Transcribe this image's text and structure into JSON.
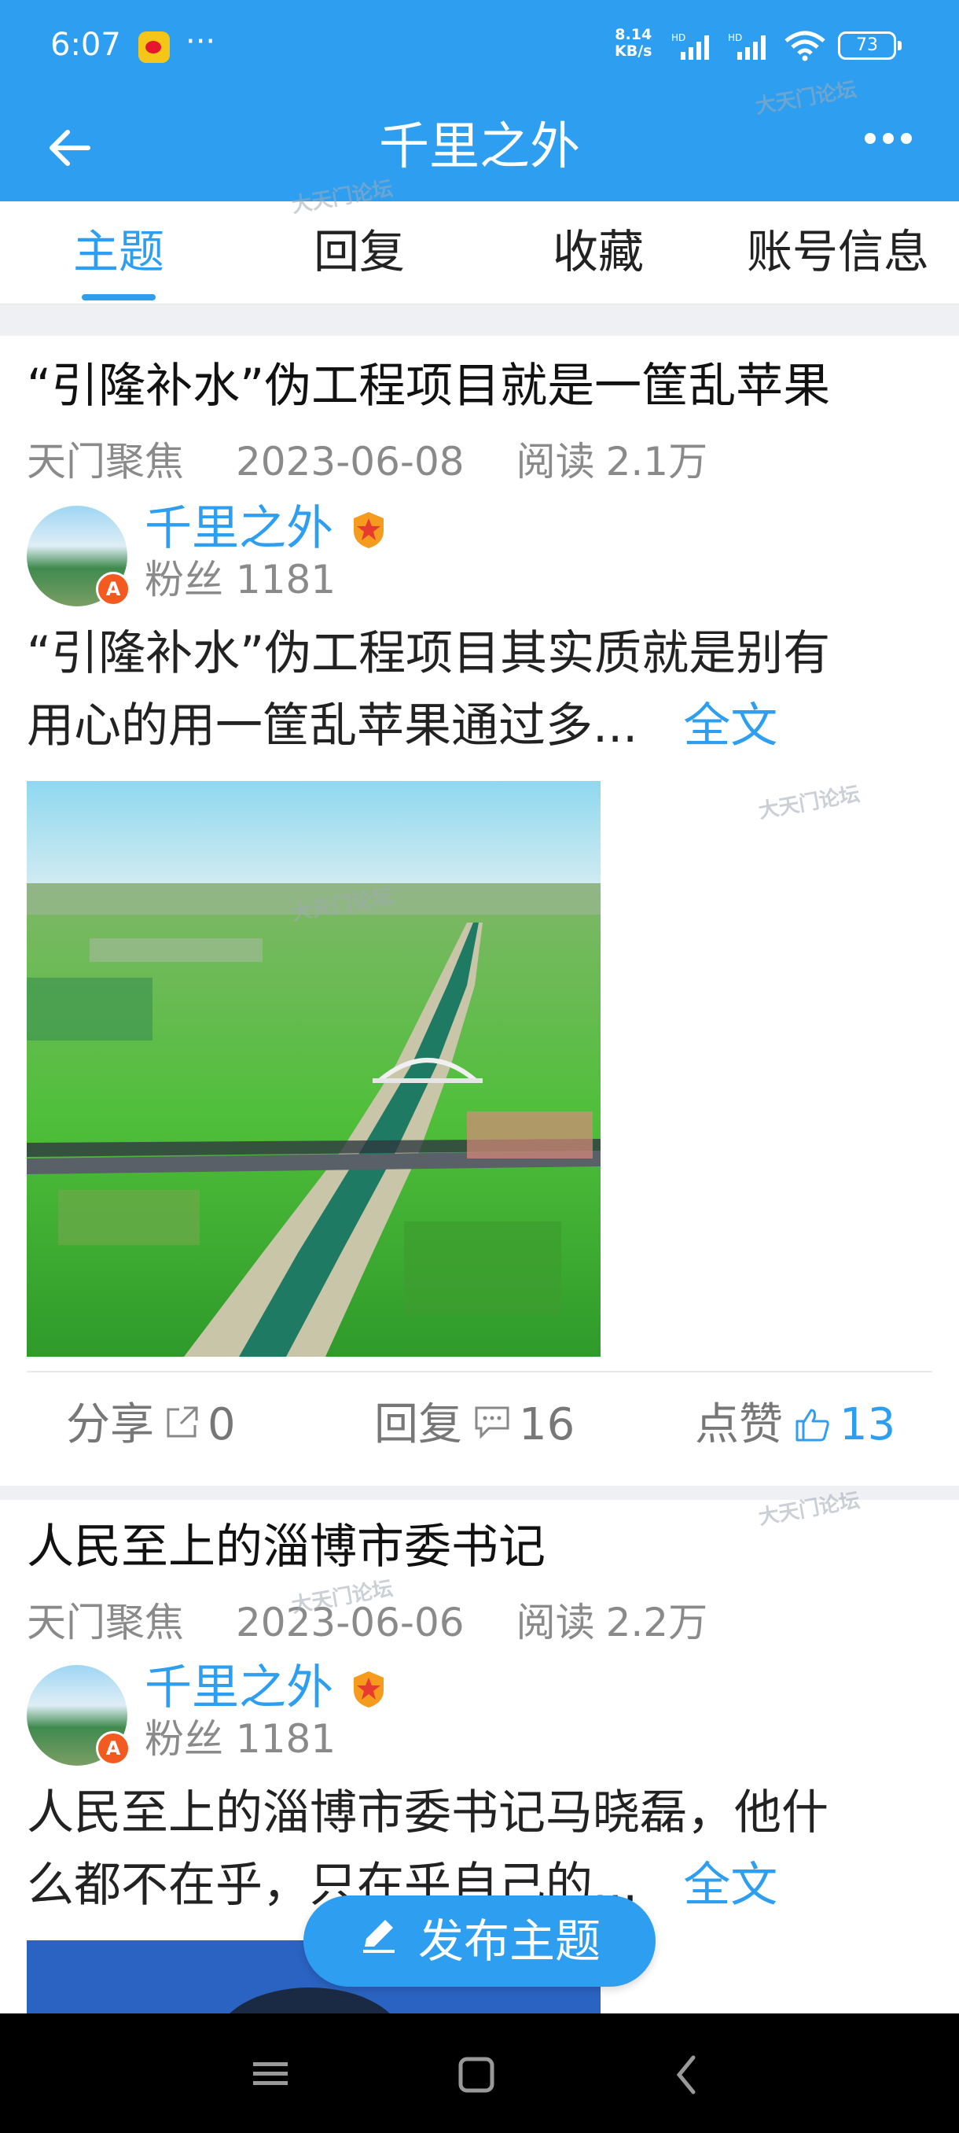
{
  "status_bar": {
    "time": "6:07",
    "app_icon": "weibo-icon",
    "more": "···",
    "net_speed_value": "8.14",
    "net_speed_unit": "KB/s",
    "signal1_label": "HD",
    "signal2_label": "HD",
    "battery": "73"
  },
  "header": {
    "title": "千里之外",
    "back_icon": "arrow-left-icon",
    "more_icon": "more-dots-icon"
  },
  "tabs": [
    {
      "label": "主题",
      "active": true
    },
    {
      "label": "回复",
      "active": false
    },
    {
      "label": "收藏",
      "active": false
    },
    {
      "label": "账号信息",
      "active": false
    }
  ],
  "posts": [
    {
      "title": "“引隆补水”伪工程项目就是一筐乱苹果",
      "board": "天门聚焦",
      "date": "2023-06-08",
      "read_label": "阅读",
      "read_count": "2.1万",
      "author": "千里之外",
      "fans_label": "粉丝",
      "fans_count": "1181",
      "avatar_badge": "A",
      "excerpt_line1": "“引隆补水”伪工程项目其实质就是别有",
      "excerpt_line2": "用心的用一筐乱苹果通过多...",
      "fulltext_label": "全文",
      "share_label": "分享",
      "share_count": "0",
      "reply_label": "回复",
      "reply_count": "16",
      "like_label": "点赞",
      "like_count": "13"
    },
    {
      "title": "人民至上的淄博市委书记",
      "board": "天门聚焦",
      "date": "2023-06-06",
      "read_label": "阅读",
      "read_count": "2.2万",
      "author": "千里之外",
      "fans_label": "粉丝",
      "fans_count": "1181",
      "avatar_badge": "A",
      "excerpt_line1": "人民至上的淄博市委书记马晓磊，他什",
      "excerpt_line2": "么都不在乎，只在乎自己的...",
      "fulltext_label": "全文"
    }
  ],
  "fab": {
    "label": "发布主题",
    "icon": "pencil-icon"
  },
  "nav_bar": {
    "menu_icon": "menu-icon",
    "home_icon": "home-square-icon",
    "back_icon": "back-chevron-icon"
  },
  "watermark_text": "大天门论坛",
  "colors": {
    "primary": "#2e9ff0",
    "text": "#222222",
    "muted": "#8a8a8a",
    "badge": "#f25a20"
  }
}
